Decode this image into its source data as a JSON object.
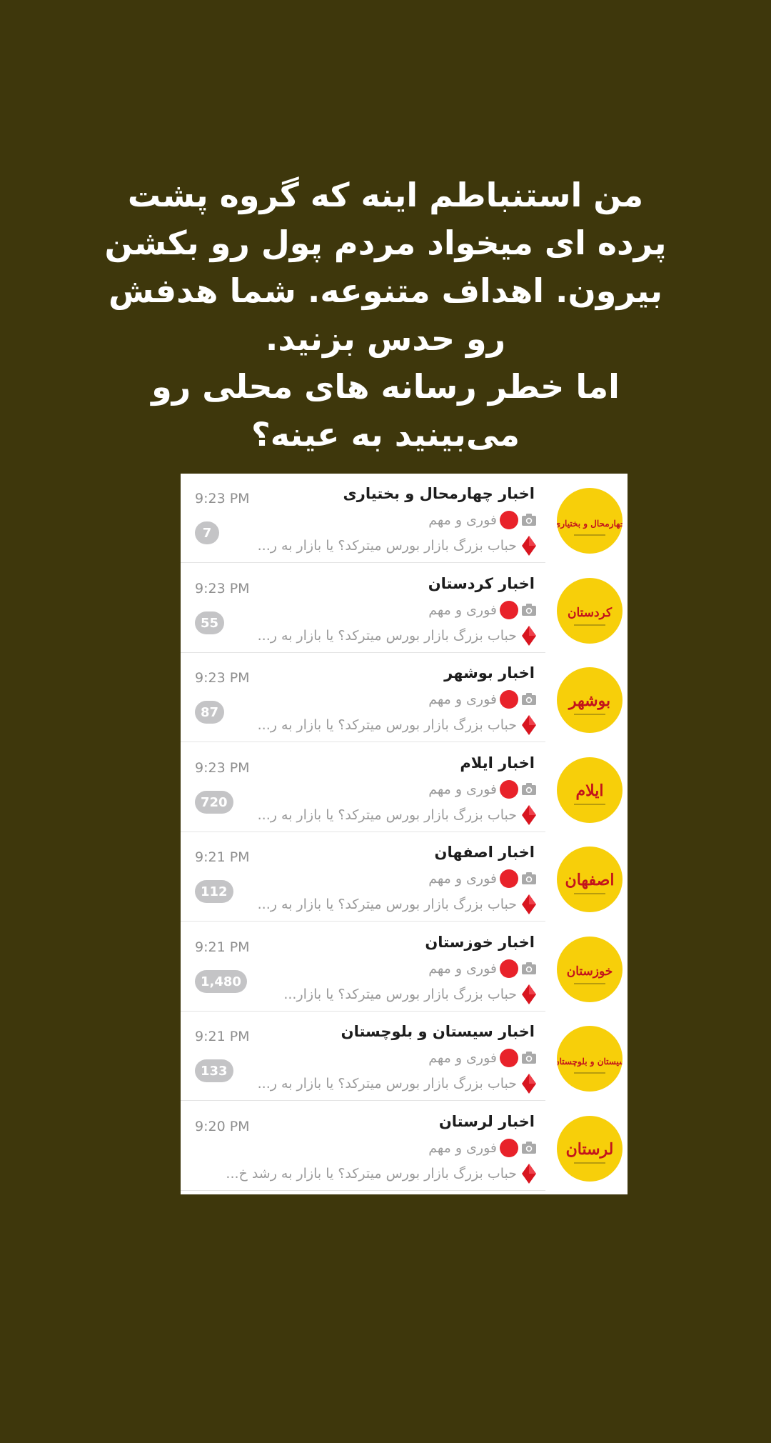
{
  "caption": {
    "lines": [
      "من استنباطم اینه که گروه پشت",
      "پرده ای میخواد مردم پول رو بکشن",
      "بیرون. اهداف متنوعه. شما هدفش",
      "رو حدس بزنید.",
      "اما خطر رسانه های محلی رو",
      "می‌بینید به عینه؟"
    ]
  },
  "colors": {
    "background": "#3e370c",
    "avatar_yellow": "#f7cf0a",
    "logo_red": "#c3141c",
    "badge_gray": "#c4c4c6"
  },
  "chats": [
    {
      "title": "اخبار چهارمحال و بختیاری",
      "time": "9:23 PM",
      "line1": "فوری و مهم",
      "line2": "حباب بزرگ بازار بورس میترکد؟ یا بازار به ر...",
      "unread": "7",
      "logo_text": "چهارمحال و بختیاری",
      "camera_icon": "camera-icon",
      "dot_icon": "red-circle-icon",
      "diamond_icon": "red-diamond-icon"
    },
    {
      "title": "اخبار کردستان",
      "time": "9:23 PM",
      "line1": "فوری و مهم",
      "line2": "حباب بزرگ بازار بورس میترکد؟ یا بازار به ر...",
      "unread": "55",
      "logo_text": "کردستان",
      "camera_icon": "camera-icon",
      "dot_icon": "red-circle-icon",
      "diamond_icon": "red-diamond-icon"
    },
    {
      "title": "اخبار بوشهر",
      "time": "9:23 PM",
      "line1": "فوری و مهم",
      "line2": "حباب بزرگ بازار بورس میترکد؟ یا بازار به ر...",
      "unread": "87",
      "logo_text": "بوشهر",
      "camera_icon": "camera-icon",
      "dot_icon": "red-circle-icon",
      "diamond_icon": "red-diamond-icon"
    },
    {
      "title": "اخبار ایلام",
      "time": "9:23 PM",
      "line1": "فوری و مهم",
      "line2": "حباب بزرگ بازار بورس میترکد؟ یا بازار به ر...",
      "unread": "720",
      "logo_text": "ایلام",
      "camera_icon": "camera-icon",
      "dot_icon": "red-circle-icon",
      "diamond_icon": "red-diamond-icon"
    },
    {
      "title": "اخبار اصفهان",
      "time": "9:21 PM",
      "line1": "فوری و مهم",
      "line2": "حباب بزرگ بازار بورس میترکد؟ یا بازار به ر...",
      "unread": "112",
      "logo_text": "اصفهان",
      "camera_icon": "camera-icon",
      "dot_icon": "red-circle-icon",
      "diamond_icon": "red-diamond-icon"
    },
    {
      "title": "اخبار خوزستان",
      "time": "9:21 PM",
      "line1": "فوری و مهم",
      "line2": "حباب بزرگ بازار بورس میترکد؟ یا بازار...",
      "unread": "1,480",
      "logo_text": "خوزستان",
      "camera_icon": "camera-icon",
      "dot_icon": "red-circle-icon",
      "diamond_icon": "red-diamond-icon"
    },
    {
      "title": "اخبار سیستان و بلوچستان",
      "time": "9:21 PM",
      "line1": "فوری و مهم",
      "line2": "حباب بزرگ بازار بورس میترکد؟ یا بازار به ر...",
      "unread": "133",
      "logo_text": "سیستان و بلوچستان",
      "camera_icon": "camera-icon",
      "dot_icon": "red-circle-icon",
      "diamond_icon": "red-diamond-icon"
    },
    {
      "title": "اخبار لرستان",
      "time": "9:20 PM",
      "line1": "فوری و مهم",
      "line2": "حباب بزرگ بازار بورس میترکد؟ یا بازار به رشد خ...",
      "unread": "",
      "logo_text": "لرستان",
      "camera_icon": "camera-icon",
      "dot_icon": "red-circle-icon",
      "diamond_icon": "red-diamond-icon"
    }
  ]
}
